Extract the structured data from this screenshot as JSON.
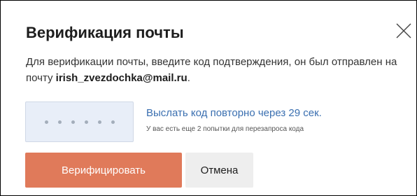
{
  "dialog": {
    "title": "Верификация почты",
    "description_prefix": "Для верификации почты, введите код подтверждения, он был отправлен на почту ",
    "email": "irish_zvezdochka@mail.ru",
    "description_suffix": "."
  },
  "code_input": {
    "placeholder_dots": 6
  },
  "resend": {
    "link_text": "Выслать код повторно через 29 сек.",
    "attempts_note": "У вас есть еще 2 попытки для перезапроса кода"
  },
  "buttons": {
    "verify_label": "Верифицировать",
    "cancel_label": "Отмена"
  },
  "colors": {
    "primary_button": "#e07a5a",
    "link": "#3a6fb0",
    "code_box_bg": "#e8eef8",
    "secondary_button": "#eeeeee"
  },
  "icons": {
    "close": "close-icon"
  }
}
